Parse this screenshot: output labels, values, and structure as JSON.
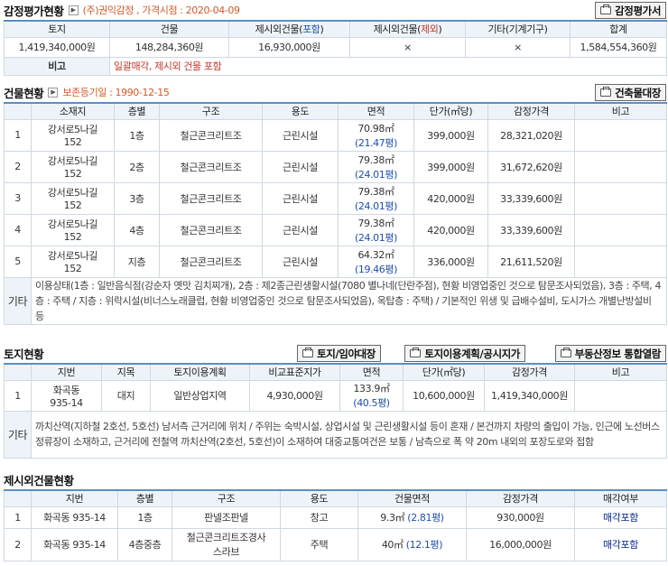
{
  "appraisal": {
    "title": "감정평가현황",
    "sub": "(주)권익감정 , 가격시점 : 2020-04-09",
    "button": "감정평가서",
    "headers": [
      "토지",
      "건물",
      "제시외건물(",
      "포함",
      ")",
      "제시외건물(",
      "제외",
      ")",
      "기타(기계기구)",
      "합계"
    ],
    "values": [
      "1,419,340,000원",
      "148,284,360원",
      "16,930,000원",
      "×",
      "×",
      "1,584,554,360원"
    ],
    "note_label": "비고",
    "note": "일괄매각, 제시외 건물 포함"
  },
  "building": {
    "title": "건물현황",
    "sub": "보존등기일 : 1990-12-15",
    "button": "건축물대장",
    "headers": [
      "",
      "소재지",
      "층별",
      "구조",
      "용도",
      "면적",
      "단가(㎡당)",
      "감정가격",
      "비고"
    ],
    "rows": [
      {
        "n": "1",
        "loc1": "강서로5나길",
        "loc2": "152",
        "floor": "1층",
        "struct": "철근콘크리트조",
        "use": "근린시설",
        "area": "70.98㎡",
        "py": "(21.47평)",
        "unit": "399,000원",
        "price": "28,321,020원"
      },
      {
        "n": "2",
        "loc1": "강서로5나길",
        "loc2": "152",
        "floor": "2층",
        "struct": "철근콘크리트조",
        "use": "근린시설",
        "area": "79.38㎡",
        "py": "(24.01평)",
        "unit": "399,000원",
        "price": "31,672,620원"
      },
      {
        "n": "3",
        "loc1": "강서로5나길",
        "loc2": "152",
        "floor": "3층",
        "struct": "철근콘크리트조",
        "use": "근린시설",
        "area": "79.38㎡",
        "py": "(24.01평)",
        "unit": "420,000원",
        "price": "33,339,600원"
      },
      {
        "n": "4",
        "loc1": "강서로5나길",
        "loc2": "152",
        "floor": "4층",
        "struct": "철근콘크리트조",
        "use": "근린시설",
        "area": "79.38㎡",
        "py": "(24.01평)",
        "unit": "420,000원",
        "price": "33,339,600원"
      },
      {
        "n": "5",
        "loc1": "강서로5나길",
        "loc2": "152",
        "floor": "지층",
        "struct": "철근콘크리트조",
        "use": "근린시설",
        "area": "64.32㎡",
        "py": "(19.46평)",
        "unit": "336,000원",
        "price": "21,611,520원"
      }
    ],
    "etc_label": "기타",
    "etc": "이용상태(1층 : 일반음식점(강순자 옛맛 김치찌개), 2층 : 제2종근린생활시설(7080 별나네(단란주점), 현황 비영업중인 것으로 탐문조사되었음), 3층 : 주택, 4층 : 주택 / 지층 : 위락시설(비너스노래클럽, 현황 비영업중인 것으로 탐문조사되었음), 옥탑층 : 주택) / 기본적인 위생 및 급배수설비, 도시가스 개별난방설비 등"
  },
  "land": {
    "title": "토지현황",
    "buttons": [
      "토지/임야대장",
      "토지이용계획/공시지가",
      "부동산정보 통합열람"
    ],
    "headers": [
      "",
      "지번",
      "지목",
      "토지이용계획",
      "비교표준지가",
      "면적",
      "단가(㎡당)",
      "감정가격",
      "비고"
    ],
    "row": {
      "n": "1",
      "lot1": "화곡동",
      "lot2": "935-14",
      "cat": "대지",
      "plan": "일반상업지역",
      "std": "4,930,000원",
      "area": "133.9㎡",
      "py": "(40.5평)",
      "unit": "10,600,000원",
      "price": "1,419,340,000원"
    },
    "etc_label": "기타",
    "etc": "까치산역(지하철 2호선, 5호선) 남서측 근거리에 위치 / 주위는 숙박시설, 상업시설 및 근린생활시설 등이 혼재 / 본건까지 차량의 출입이 가능, 인근에 노선버스 정류장이 소재하고, 근거리에 전철역 까치산역(2호선, 5호선)이 소재하여 대중교통여건은 보통 / 남측으로 폭 약 20m 내외의 포장도로와 접함"
  },
  "extra": {
    "title": "제시외건물현황",
    "headers": [
      "",
      "지번",
      "층별",
      "구조",
      "용도",
      "건물면적",
      "감정가격",
      "매각여부"
    ],
    "rows": [
      {
        "n": "1",
        "lot": "화곡동 935-14",
        "floor": "1층",
        "struct1": "판넬조판넬",
        "struct2": "",
        "use": "창고",
        "area": "9.3㎡",
        "py": "(2.81평)",
        "price": "930,000원",
        "sale": "매각포함"
      },
      {
        "n": "2",
        "lot": "화곡동 935-14",
        "floor": "4층중층",
        "struct1": "철근콘크리트조경사",
        "struct2": "스라브",
        "use": "주택",
        "area": "40㎡",
        "py": "(12.1평)",
        "price": "16,000,000원",
        "sale": "매각포함"
      }
    ]
  }
}
